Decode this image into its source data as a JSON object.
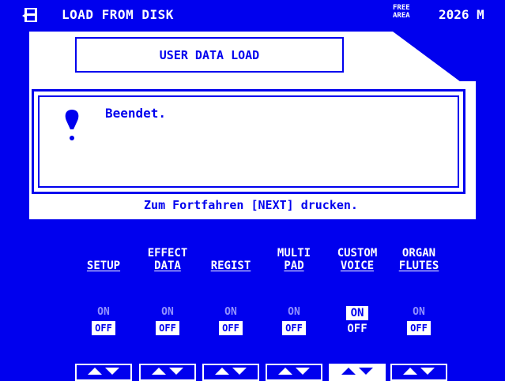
{
  "header": {
    "title": "LOAD FROM DISK",
    "free_area_label_1": "FREE",
    "free_area_label_2": "AREA",
    "free_value": "2026 M",
    "icon": "disk-load-icon"
  },
  "dialog": {
    "section_title": "USER DATA LOAD",
    "message": "Beendet.",
    "message_icon": "exclamation-icon",
    "prompt": "Zum Fortfahren [NEXT] drucken."
  },
  "params": [
    {
      "label_1": "",
      "label_2": "SETUP",
      "on": "ON",
      "off": "OFF",
      "state": "off"
    },
    {
      "label_1": "EFFECT",
      "label_2": "DATA",
      "on": "ON",
      "off": "OFF",
      "state": "off"
    },
    {
      "label_1": "",
      "label_2": "REGIST",
      "on": "ON",
      "off": "OFF",
      "state": "off"
    },
    {
      "label_1": "MULTI",
      "label_2": "PAD",
      "on": "ON",
      "off": "OFF",
      "state": "off"
    },
    {
      "label_1": "CUSTOM",
      "label_2": "VOICE",
      "on": "ON",
      "off": "OFF",
      "state": "on"
    },
    {
      "label_1": "ORGAN",
      "label_2": "FLUTES",
      "on": "ON",
      "off": "OFF",
      "state": "off"
    }
  ],
  "colors": {
    "background": "#0000ee",
    "foreground": "#ffffff"
  }
}
